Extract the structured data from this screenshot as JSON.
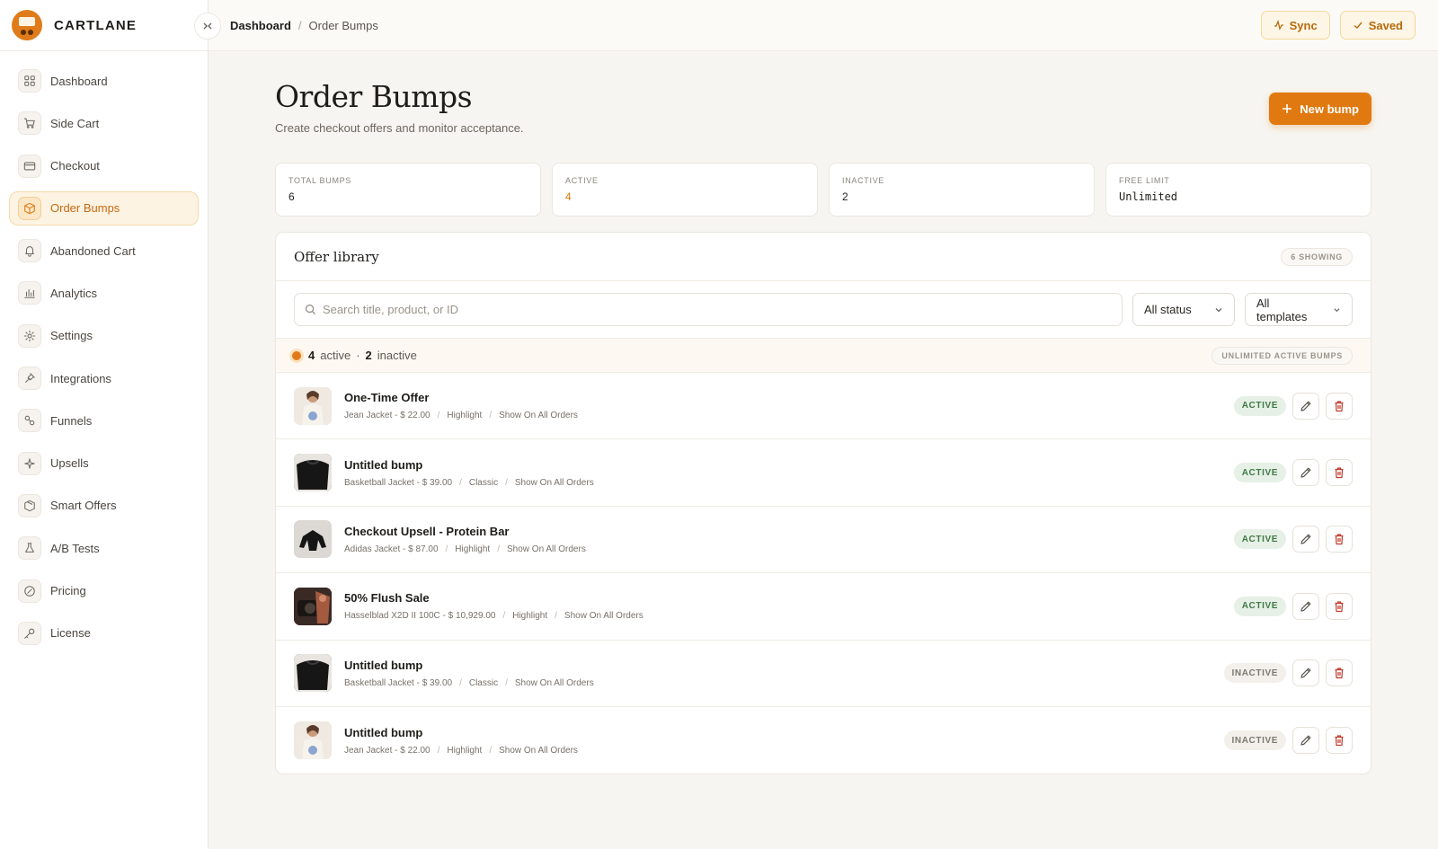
{
  "brand": {
    "name": "CARTLANE"
  },
  "breadcrumb": {
    "root": "Dashboard",
    "separator": "/",
    "current": "Order Bumps"
  },
  "top_actions": {
    "sync_label": "Sync",
    "saved_label": "Saved"
  },
  "sidebar": {
    "items": [
      {
        "label": "Dashboard",
        "icon": "grid-icon"
      },
      {
        "label": "Side Cart",
        "icon": "cart-icon"
      },
      {
        "label": "Checkout",
        "icon": "card-icon"
      },
      {
        "label": "Order Bumps",
        "icon": "box-icon",
        "active": true
      },
      {
        "label": "Abandoned Cart",
        "icon": "bell-icon"
      },
      {
        "label": "Analytics",
        "icon": "bar-chart-icon"
      },
      {
        "label": "Settings",
        "icon": "gear-icon"
      },
      {
        "label": "Integrations",
        "icon": "plug-icon"
      },
      {
        "label": "Funnels",
        "icon": "funnel-icon"
      },
      {
        "label": "Upsells",
        "icon": "sparkle-icon"
      },
      {
        "label": "Smart Offers",
        "icon": "package-icon"
      },
      {
        "label": "A/B Tests",
        "icon": "flask-icon"
      },
      {
        "label": "Pricing",
        "icon": "badge-icon"
      },
      {
        "label": "License",
        "icon": "key-icon"
      }
    ]
  },
  "page": {
    "title": "Order Bumps",
    "subtitle": "Create checkout offers and monitor acceptance.",
    "new_button": "New bump"
  },
  "stats": [
    {
      "label": "TOTAL BUMPS",
      "value": "6"
    },
    {
      "label": "ACTIVE",
      "value": "4"
    },
    {
      "label": "INACTIVE",
      "value": "2"
    },
    {
      "label": "FREE LIMIT",
      "value": "Unlimited"
    }
  ],
  "library": {
    "title": "Offer library",
    "showing": "6 SHOWING",
    "search_placeholder": "Search title, product, or ID",
    "status_filter": "All status",
    "template_filter": "All templates",
    "summary_active_count": "4",
    "summary_active_word": "active",
    "summary_dot_sep": "·",
    "summary_inactive_count": "2",
    "summary_inactive_word": "inactive",
    "limit_badge": "UNLIMITED ACTIVE BUMPS",
    "rows": [
      {
        "title": "One-Time Offer",
        "product": "Jean Jacket - $ 22.00",
        "template": "Highlight",
        "rule": "Show On All Orders",
        "status": "ACTIVE",
        "thumb": "light"
      },
      {
        "title": "Untitled bump",
        "product": "Basketball Jacket - $ 39.00",
        "template": "Classic",
        "rule": "Show On All Orders",
        "status": "ACTIVE",
        "thumb": "dark"
      },
      {
        "title": "Checkout Upsell - Protein Bar",
        "product": "Adidas Jacket - $ 87.00",
        "template": "Highlight",
        "rule": "Show On All Orders",
        "status": "ACTIVE",
        "thumb": "grey"
      },
      {
        "title": "50% Flush Sale",
        "product": "Hasselblad X2D II 100C - $ 10,929.00",
        "template": "Highlight",
        "rule": "Show On All Orders",
        "status": "ACTIVE",
        "thumb": "photo"
      },
      {
        "title": "Untitled bump",
        "product": "Basketball Jacket - $ 39.00",
        "template": "Classic",
        "rule": "Show On All Orders",
        "status": "INACTIVE",
        "thumb": "dark"
      },
      {
        "title": "Untitled bump",
        "product": "Jean Jacket - $ 22.00",
        "template": "Highlight",
        "rule": "Show On All Orders",
        "status": "INACTIVE",
        "thumb": "light"
      }
    ]
  },
  "colors": {
    "accent": "#e0790f",
    "active_badge": "#3f7a46",
    "danger": "#c0392b"
  }
}
